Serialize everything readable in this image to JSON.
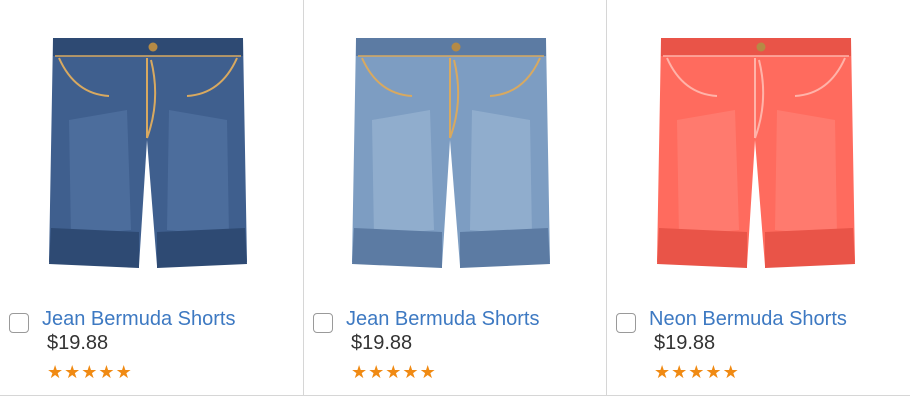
{
  "products": [
    {
      "name": "Jean Bermuda Shorts",
      "price": "$19.88",
      "rating": 5,
      "max_rating": 5,
      "color": "#3f5f8e",
      "color_dark": "#2e4a73",
      "color_light": "#5d7fae",
      "image_icon": "dark-denim-shorts-image"
    },
    {
      "name": "Jean Bermuda Shorts",
      "price": "$19.88",
      "rating": 5,
      "max_rating": 5,
      "color": "#7d9dc2",
      "color_dark": "#5c7ba3",
      "color_light": "#a9c2dc",
      "image_icon": "light-denim-shorts-image"
    },
    {
      "name": "Neon Bermuda Shorts",
      "price": "$19.88",
      "rating": 5,
      "max_rating": 5,
      "color": "#ff6b5e",
      "color_dark": "#e95448",
      "color_light": "#ff8d82",
      "image_icon": "neon-coral-shorts-image"
    }
  ],
  "colors": {
    "link": "#3d79c2",
    "price": "#333333",
    "star": "#f08a13",
    "divider": "#d6d6d6"
  }
}
